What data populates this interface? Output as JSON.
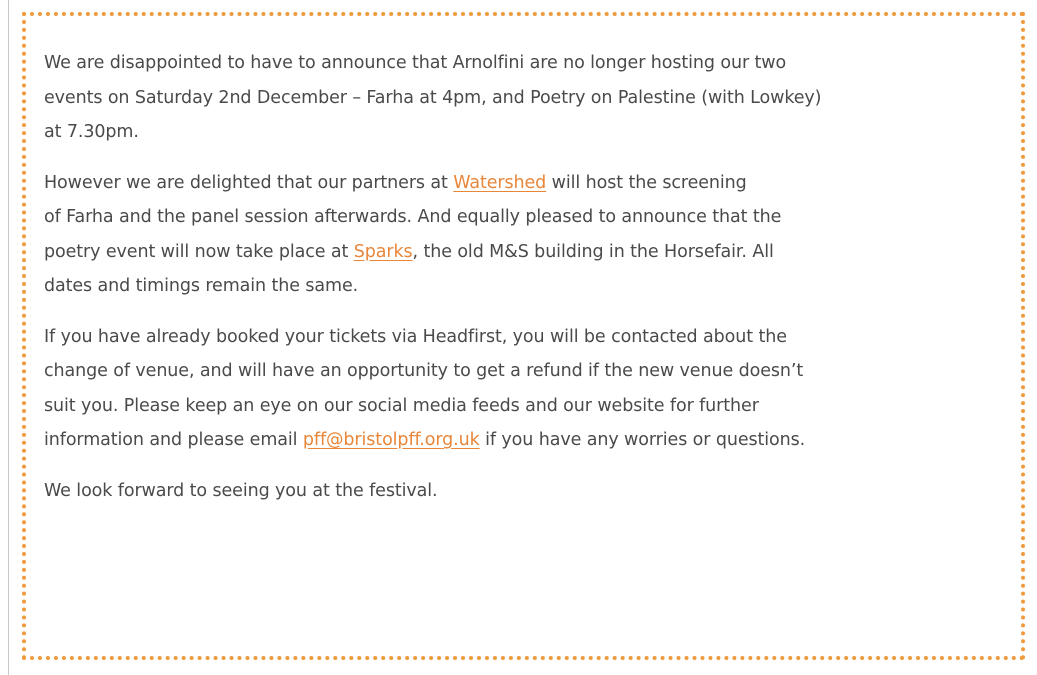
{
  "notice": {
    "paragraph1": {
      "line1": "We are disappointed to have to announce that Arnolfini are no longer hosting our two",
      "line2": "events on Saturday 2nd December – Farha at 4pm, and Poetry on Palestine (with Lowkey)",
      "line3": "at 7.30pm."
    },
    "paragraph2": {
      "line1_before": "However we are delighted that our partners at ",
      "line1_link": "Watershed",
      "line1_after": " will host the screening",
      "line2": "of Farha and the panel session afterwards.  And equally pleased to announce that the",
      "line3_before": "poetry event will now take place at ",
      "line3_link": "Sparks",
      "line3_after": ", the old M&S building in the Horsefair.  All",
      "line4": "dates and timings remain the same."
    },
    "paragraph3": {
      "line1": "If you have already booked your tickets via Headfirst, you will be contacted about the",
      "line2": "change of venue, and will have an opportunity to get a refund if the new venue doesn’t",
      "line3": "suit you.  Please keep an eye on our social media feeds and our website for further",
      "line4_before": "information and please email ",
      "line4_link": "pff@bristolpff.org.uk",
      "line4_after": " if you have any worries or questions."
    },
    "paragraph4": {
      "line1": "We look forward to seeing you at the festival."
    }
  },
  "colors": {
    "border": "#ef9a3c",
    "link": "#e8863a",
    "text": "#4a4a4a"
  }
}
